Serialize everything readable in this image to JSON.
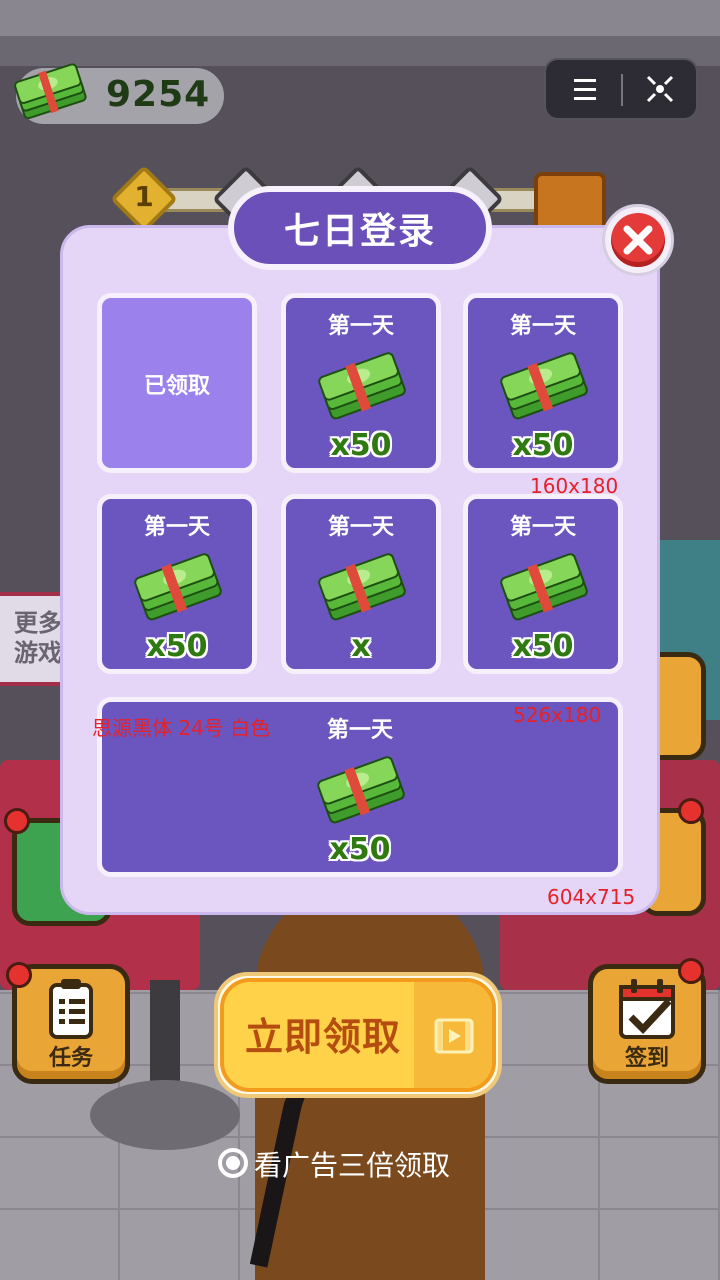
{
  "hud": {
    "cash_value": "9254",
    "cash_icon": "money-stack-icon",
    "menu_icon": "hamburger-icon",
    "close_icon": "target-close-icon"
  },
  "progress": {
    "first_node": "1",
    "reward_icon": "treasure-chest-icon"
  },
  "side": {
    "more_games": "更多游戏",
    "task_label": "任务",
    "sign_label": "签到"
  },
  "dialog": {
    "title": "七日登录",
    "close_icon": "close-x-icon",
    "cards": [
      {
        "state": "claimed",
        "text": "已领取"
      },
      {
        "day": "第一天",
        "amount": "x50",
        "icon": "money-stack-icon"
      },
      {
        "day": "第一天",
        "amount": "x50",
        "icon": "money-stack-icon"
      },
      {
        "day": "第一天",
        "amount": "x50",
        "icon": "money-stack-icon"
      },
      {
        "day": "第一天",
        "amount": "x",
        "icon": "money-stack-icon"
      },
      {
        "day": "第一天",
        "amount": "x50",
        "icon": "money-stack-icon"
      },
      {
        "day": "第一天",
        "amount": "x50",
        "icon": "money-stack-icon"
      }
    ]
  },
  "annotations": {
    "card_size": "160x180",
    "big_card_size": "526x180",
    "font_note": "思源黑体  24号  白色",
    "panel_size": "604x715"
  },
  "claim": {
    "label": "立即领取",
    "video_icon": "video-ad-icon"
  },
  "ad": {
    "label": "看广告三倍领取"
  },
  "colors": {
    "panel": "#e5d6f7",
    "card": "#6b55be",
    "card_claimed": "#9a81ec",
    "amount_green": "#2f7a10",
    "button_yellow": "#ffd24a"
  }
}
